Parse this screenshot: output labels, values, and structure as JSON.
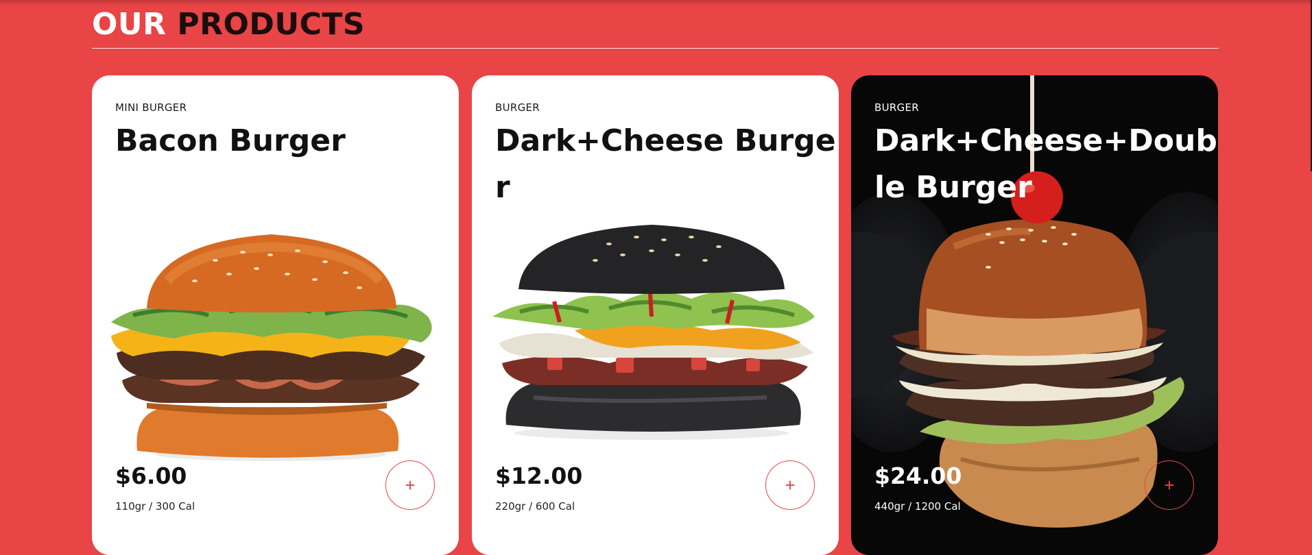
{
  "section": {
    "title_part1": "OUR",
    "title_part2": "PRODUCTS"
  },
  "products": [
    {
      "category": "MINI BURGER",
      "name": "Bacon Burger",
      "price": "$6.00",
      "meta": "110gr / 300 Cal",
      "add_label": "+",
      "image_icon": "bacon-burger-image"
    },
    {
      "category": "BURGER",
      "name": "Dark+Cheese Burger",
      "price": "$12.00",
      "meta": "220gr / 600 Cal",
      "add_label": "+",
      "image_icon": "dark-cheese-burger-image"
    },
    {
      "category": "BURGER",
      "name": "Dark+Cheese+Double Burger",
      "price": "$24.00",
      "meta": "440gr / 1200 Cal",
      "add_label": "+",
      "image_icon": "double-burger-image"
    }
  ],
  "colors": {
    "background": "#e94446",
    "card_light": "#ffffff",
    "card_dark": "#070707",
    "accent": "#e94446",
    "title_dark": "#1a0d0d"
  }
}
